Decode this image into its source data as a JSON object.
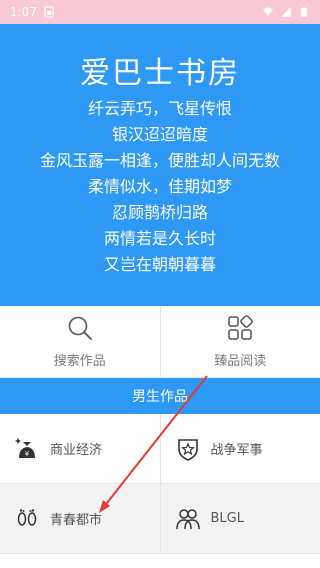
{
  "status_bar": {
    "time": "1:07",
    "colors": {
      "background": "#f9c9d6",
      "text": "#ffffff"
    },
    "icons": [
      "sim-card-icon",
      "wifi-icon",
      "signal-icon",
      "battery-icon"
    ]
  },
  "header": {
    "title": "爱巴士书房",
    "poem": [
      "纤云弄巧，飞星传恨",
      "银汉迢迢暗度",
      "金风玉露一相逢，便胜却人间无数",
      "柔情似水，佳期如梦",
      "忍顾鹊桥归路",
      "两情若是久长时",
      "又岂在朝朝暮暮"
    ],
    "colors": {
      "background": "#2e98f5",
      "text": "#ffffff"
    }
  },
  "quick_actions": [
    {
      "label": "搜索作品",
      "icon": "search-icon"
    },
    {
      "label": "臻品阅读",
      "icon": "apps-grid-icon"
    }
  ],
  "section": {
    "title": "男生作品"
  },
  "categories": [
    {
      "label": "商业经济",
      "icon": "money-bag-icon",
      "shaded": false
    },
    {
      "label": "战争军事",
      "icon": "star-shield-icon",
      "shaded": false
    },
    {
      "label": "青春都市",
      "icon": "footprints-icon",
      "shaded": true
    },
    {
      "label": "BLGL",
      "icon": "people-icon",
      "shaded": true
    }
  ],
  "annotation": {
    "type": "arrow",
    "color": "#e53935"
  }
}
